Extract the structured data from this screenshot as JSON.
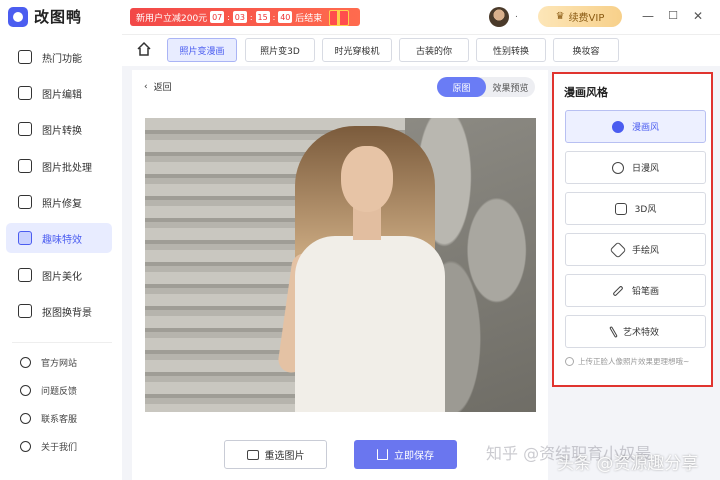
{
  "app": {
    "name": "改图鸭"
  },
  "promo": {
    "text": "新用户立减200元",
    "countdown": [
      "07",
      "03",
      "15",
      "40"
    ],
    "suffix": "后结束"
  },
  "user": {
    "name": "."
  },
  "vip": {
    "label": "续费VIP"
  },
  "window": {
    "min": "—",
    "max": "☐",
    "close": "✕"
  },
  "sidebar": {
    "items": [
      {
        "label": "热门功能",
        "icon": "flame-icon"
      },
      {
        "label": "图片编辑",
        "icon": "image-edit-icon"
      },
      {
        "label": "图片转换",
        "icon": "convert-icon"
      },
      {
        "label": "图片批处理",
        "icon": "batch-icon"
      },
      {
        "label": "照片修复",
        "icon": "repair-icon"
      },
      {
        "label": "趣味特效",
        "icon": "magic-wand-icon",
        "active": true
      },
      {
        "label": "图片美化",
        "icon": "beautify-icon"
      },
      {
        "label": "抠图换背景",
        "icon": "cutout-icon"
      }
    ],
    "links": [
      {
        "label": "官方网站",
        "icon": "website-icon"
      },
      {
        "label": "问题反馈",
        "icon": "feedback-icon"
      },
      {
        "label": "联系客服",
        "icon": "support-icon"
      },
      {
        "label": "关于我们",
        "icon": "info-icon"
      }
    ]
  },
  "tabs": [
    {
      "label": "照片变漫画",
      "active": true
    },
    {
      "label": "照片变3D"
    },
    {
      "label": "时光穿梭机"
    },
    {
      "label": "古装的你"
    },
    {
      "label": "性别转换"
    },
    {
      "label": "换妆容"
    }
  ],
  "main": {
    "back_label": "返回",
    "toggle": {
      "original": "原图",
      "preview": "效果预览"
    },
    "reselect_label": "重选图片",
    "save_label": "立即保存"
  },
  "panel": {
    "title": "漫画风格",
    "styles": [
      {
        "label": "漫画风",
        "icon": "bear-icon",
        "active": true
      },
      {
        "label": "日漫风",
        "icon": "eye-icon"
      },
      {
        "label": "3D风",
        "icon": "cube-icon"
      },
      {
        "label": "手绘风",
        "icon": "eraser-icon"
      },
      {
        "label": "铅笔画",
        "icon": "pencil-icon"
      },
      {
        "label": "艺术特效",
        "icon": "sparkle-wand-icon"
      }
    ],
    "hint": "上传正脸人像照片效果更理想哦~"
  },
  "watermarks": {
    "zhihu": "知乎 @资结职育小奴最",
    "toutiao": "头条 @资源趣分享"
  },
  "colors": {
    "accent": "#4b5df0",
    "save_button": "#6a76ef",
    "highlight_border": "#e0342f",
    "promo": "#f24848",
    "vip": "#f7d08a"
  }
}
